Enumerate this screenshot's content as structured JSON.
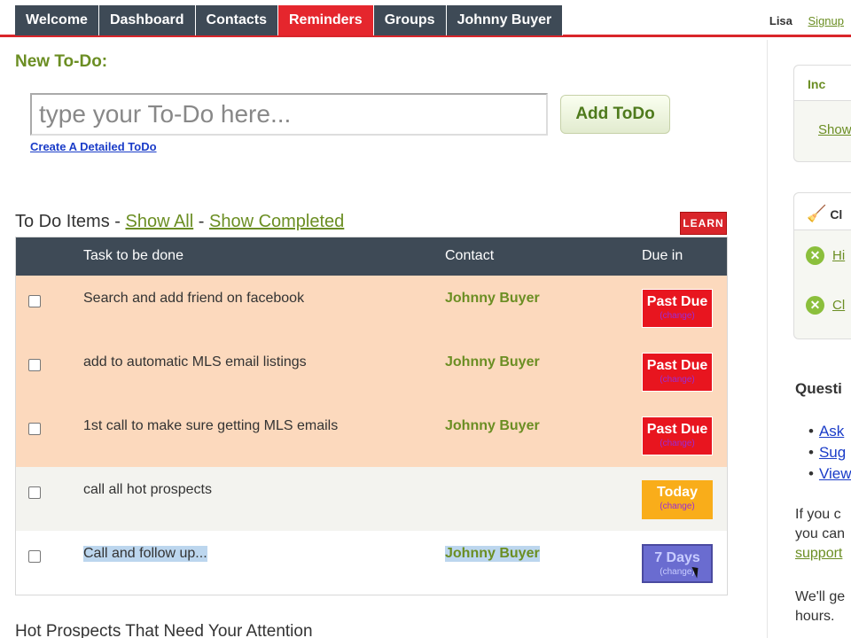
{
  "nav": {
    "tabs": [
      {
        "label": "Welcome"
      },
      {
        "label": "Dashboard"
      },
      {
        "label": "Contacts"
      },
      {
        "label": "Reminders",
        "active": true
      },
      {
        "label": "Groups"
      },
      {
        "label": "Johnny Buyer"
      }
    ],
    "user": "Lisa",
    "signup": "Signup"
  },
  "new_todo": {
    "title": "New To-Do:",
    "placeholder": "type your To-Do here...",
    "add_label": "Add ToDo",
    "detailed_link": "Create A Detailed ToDo"
  },
  "items": {
    "title": "To Do Items",
    "sep1": " - ",
    "show_all": "Show All",
    "sep2": " - ",
    "show_completed": "Show Completed",
    "learn": "LEARN",
    "columns": {
      "task": "Task to be done",
      "contact": "Contact",
      "due": "Due in"
    },
    "rows": [
      {
        "task": "Search and add friend on facebook",
        "contact": "Johnny Buyer",
        "due": "Past Due",
        "change": "(change)"
      },
      {
        "task": "add to automatic MLS email listings",
        "contact": "Johnny Buyer",
        "due": "Past Due",
        "change": "(change)"
      },
      {
        "task": "1st call to make sure getting MLS emails",
        "contact": "Johnny Buyer",
        "due": "Past Due",
        "change": "(change)"
      },
      {
        "task": "call all hot prospects",
        "contact": "",
        "due": "Today",
        "change": "(change)"
      },
      {
        "task": "Call and follow up...",
        "contact": "Johnny Buyer",
        "due": "7 Days",
        "change": "(change)"
      }
    ]
  },
  "hot_prospects_title": "Hot Prospects That Need Your Attention",
  "sidebar": {
    "box1_head": "Inc",
    "box1_link": "Show",
    "box2_head": "Cl",
    "box2_links": [
      "Hi",
      "Cl"
    ],
    "questions_title": "Questi",
    "question_links": [
      "Ask",
      "Sug",
      "View"
    ],
    "para1_line1": "If you c",
    "para1_line2": "you can",
    "para1_link": "support",
    "para2_line1": "We'll ge",
    "para2_line2": "hours."
  }
}
